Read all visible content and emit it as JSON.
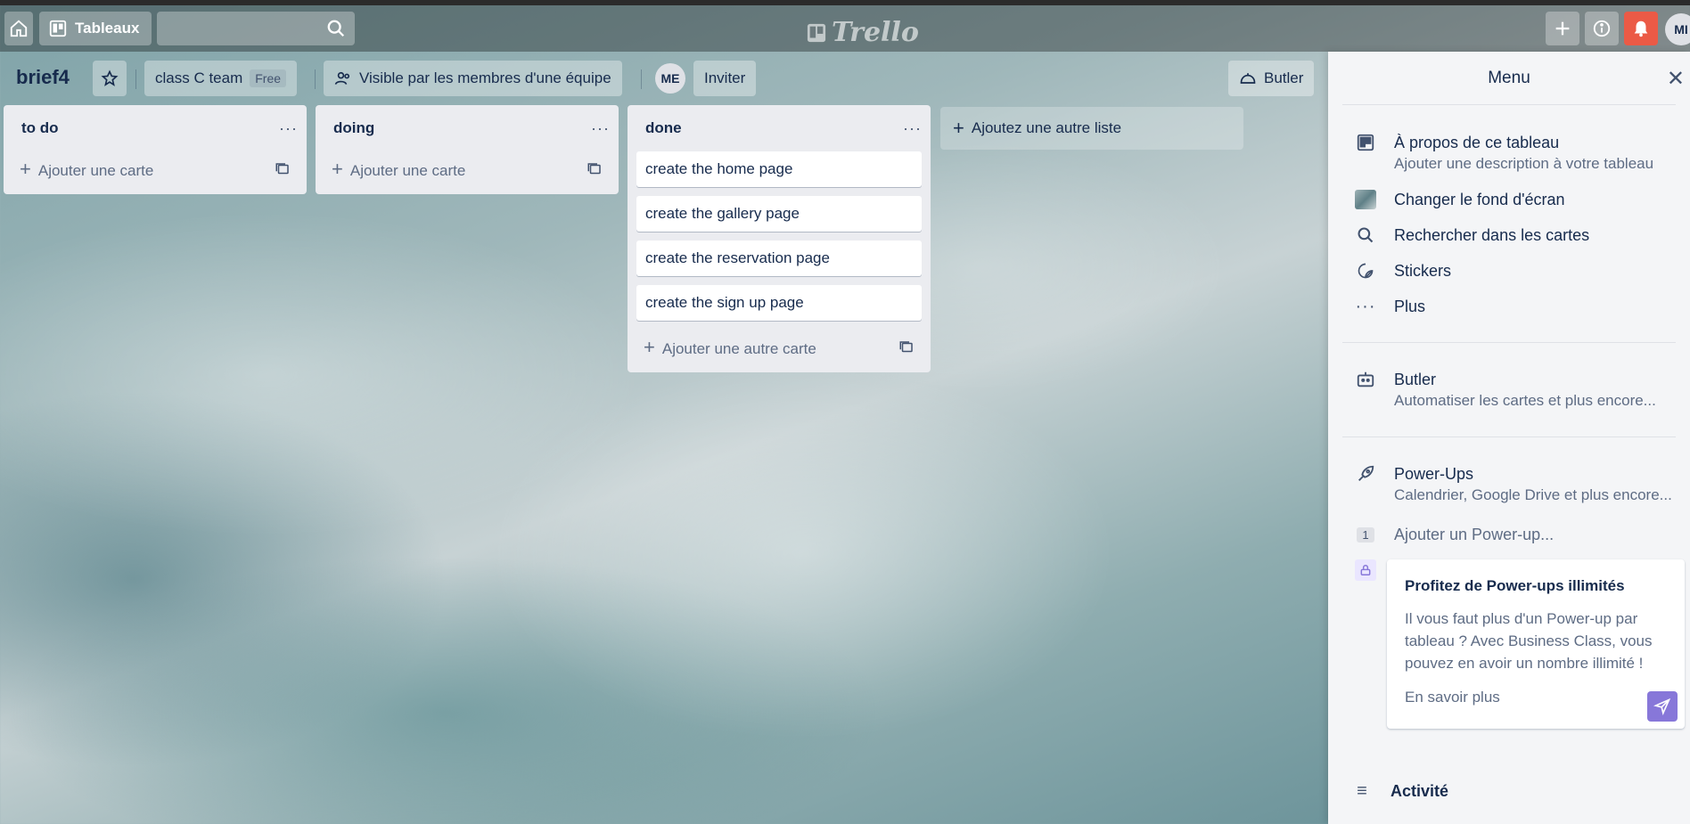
{
  "header": {
    "boards_label": "Tableaux",
    "search_value": "",
    "logo_text": "Trello",
    "avatar_initials": "MI"
  },
  "board": {
    "title": "brief4",
    "team_name": "class C team",
    "team_badge": "Free",
    "visibility": "Visible par les membres d'une équipe",
    "member_initials": "ME",
    "invite_label": "Inviter",
    "butler_label": "Butler"
  },
  "lists": [
    {
      "title": "to do",
      "cards": [],
      "add_label": "Ajouter une carte"
    },
    {
      "title": "doing",
      "cards": [],
      "add_label": "Ajouter une carte"
    },
    {
      "title": "done",
      "cards": [
        "create the home page",
        "create the gallery page",
        "create the reservation page",
        "create the sign up page"
      ],
      "add_label": "Ajouter une autre carte"
    }
  ],
  "add_list_label": "Ajoutez une autre liste",
  "menu": {
    "title": "Menu",
    "about_title": "À propos de ce tableau",
    "about_sub": "Ajouter une description à votre tableau",
    "background": "Changer le fond d'écran",
    "search_cards": "Rechercher dans les cartes",
    "stickers": "Stickers",
    "more": "Plus",
    "butler_title": "Butler",
    "butler_sub": "Automatiser les cartes et plus encore...",
    "powerups_title": "Power-Ups",
    "powerups_sub": "Calendrier, Google Drive et plus encore...",
    "powerup_count": "1",
    "add_powerup": "Ajouter un Power-up...",
    "promo_title": "Profitez de Power-ups illimités",
    "promo_text": "Il vous faut plus d'un Power-up par tableau ? Avec Business Class, vous pouvez en avoir un nombre illimité !",
    "promo_link": "En savoir plus",
    "activity": "Activité"
  },
  "colors": {
    "promo_accent": "#8777d9",
    "notification": "#eb5a46"
  }
}
